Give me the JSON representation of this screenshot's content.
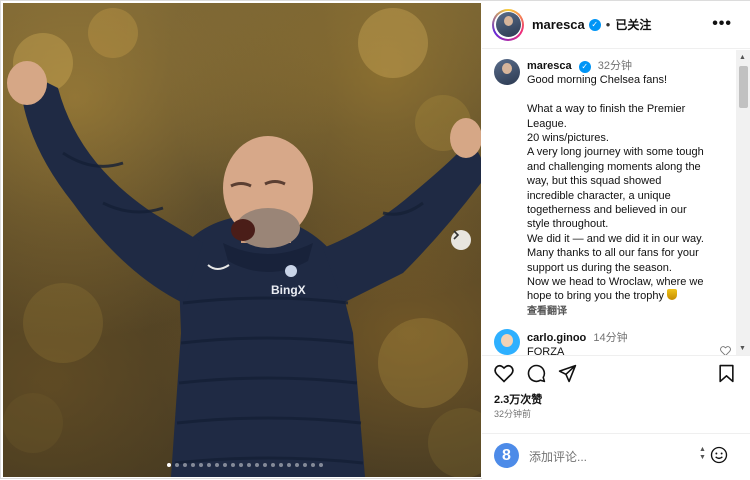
{
  "post": {
    "username": "maresca",
    "separator": "•",
    "follow_status": "已关注",
    "more_label": "•••"
  },
  "caption": {
    "username": "maresca",
    "time": "32分钟",
    "lines": [
      "Good morning Chelsea fans!",
      "",
      "What a way to finish the Premier",
      "League.",
      "20 wins/pictures.",
      "A very long journey with some tough",
      "and challenging moments along the",
      "way, but this squad showed",
      "incredible character, a unique",
      "togetherness and believed in our",
      "style throughout.",
      "We did it — and we did it in our way.",
      "Many thanks to all our fans for your",
      "support us during the season.",
      "Now we head to Wroclaw, where we",
      "hope to bring you the trophy"
    ],
    "translate": "查看翻译"
  },
  "comment": {
    "username": "carlo.ginoo",
    "time": "14分钟",
    "text": "FORZA"
  },
  "stats": {
    "likes": "2.3万次赞",
    "posted": "32分钟前"
  },
  "composer": {
    "avatar_letter": "8",
    "placeholder": "添加评论..."
  },
  "media": {
    "jacket_logo": "BingX",
    "slide_count": 20,
    "active_slide": 1
  },
  "icons": {
    "verified": "verified-badge-icon",
    "like": "heart-icon",
    "comment": "comment-icon",
    "share": "share-icon",
    "save": "bookmark-icon",
    "more": "more-dots-icon",
    "next": "chevron-right-icon",
    "emoji": "emoji-icon",
    "trophy": "trophy-icon"
  },
  "colors": {
    "verified": "#0095f6",
    "jacket": "#1f2a44",
    "text_secondary": "#737373"
  }
}
